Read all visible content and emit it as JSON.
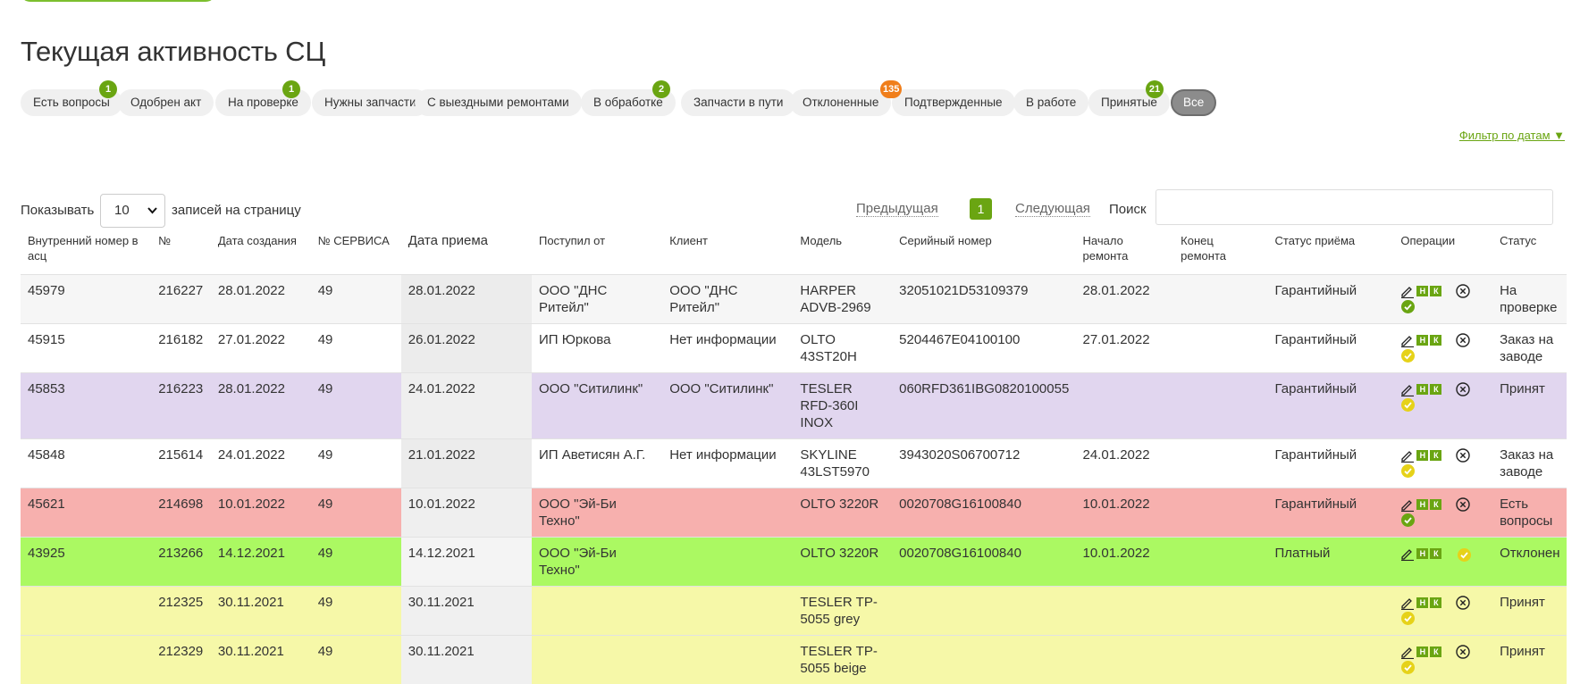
{
  "page": {
    "title": "Текущая активность СЦ",
    "date_filter": "Фильтр по датам ▼"
  },
  "filters": [
    {
      "label": "Есть вопросы",
      "badge": "1",
      "badge_color": "green"
    },
    {
      "label": "Одобрен акт",
      "badge": null
    },
    {
      "label": "На проверке",
      "badge": "1",
      "badge_color": "green"
    },
    {
      "label": "Нужны запчасти",
      "badge": null
    },
    {
      "label": "С выездными ремонтами",
      "badge": null
    },
    {
      "label": "В обработке",
      "badge": "2",
      "badge_color": "green"
    },
    {
      "label": "Запчасти в пути",
      "badge": null
    },
    {
      "label": "Отклоненные",
      "badge": null
    },
    {
      "label": "Подтвержденные",
      "badge": "135",
      "badge_color": "orange"
    },
    {
      "label": "В работе",
      "badge": null
    },
    {
      "label": "Принятые",
      "badge": "21",
      "badge_color": "green"
    },
    {
      "label": "Все",
      "badge": null,
      "active": true
    }
  ],
  "controls": {
    "show_label": "Показывать",
    "page_size": "10",
    "per_page_label": "записей на страницу",
    "prev": "Предыдущая",
    "page": "1",
    "next": "Следующая",
    "search_label": "Поиск",
    "search_value": ""
  },
  "table": {
    "headers": [
      "Внутренний номер в асц",
      "№",
      "Дата создания",
      "№ СЕРВИСА",
      "Дата приема",
      "Поступил от",
      "Клиент",
      "Модель",
      "Серийный номер",
      "Начало ремонта",
      "Конец ремонта",
      "Статус приёма",
      "Операции",
      "Статус"
    ],
    "ops_labels": {
      "h": "Н",
      "k": "К"
    },
    "rows": [
      {
        "style": "gray",
        "internal": "45979",
        "num": "216227",
        "created": "28.01.2022",
        "service": "49",
        "received": "28.01.2022",
        "from": "ООО \"ДНС Ритейл\"",
        "client": "ООО \"ДНС Ритейл\"",
        "model": "HARPER ADVB-2969",
        "serial": "32051021D53109379",
        "start": "28.01.2022",
        "end": "",
        "intake_status": "Гарантийный",
        "check_color": "#6aa512",
        "inline_check": false,
        "status": "На проверке"
      },
      {
        "style": "white",
        "internal": "45915",
        "num": "216182",
        "created": "27.01.2022",
        "service": "49",
        "received": "26.01.2022",
        "from": "ИП Юркова",
        "client": "Нет информации",
        "model": "OLTO 43ST20H",
        "serial": "5204467E04100100",
        "start": "27.01.2022",
        "end": "",
        "intake_status": "Гарантийный",
        "check_color": "#e6d219",
        "inline_check": false,
        "status": "Заказ на заводе"
      },
      {
        "style": "purple",
        "internal": "45853",
        "num": "216223",
        "created": "28.01.2022",
        "service": "49",
        "received": "24.01.2022",
        "from": "ООО \"Ситилинк\"",
        "client": "ООО \"Ситилинк\"",
        "model": "TESLER RFD-360I INOX",
        "serial": "060RFD361IBG0820100055",
        "start": "",
        "end": "",
        "intake_status": "Гарантийный",
        "check_color": "#e6d219",
        "inline_check": false,
        "status": "Принят"
      },
      {
        "style": "white",
        "internal": "45848",
        "num": "215614",
        "created": "24.01.2022",
        "service": "49",
        "received": "21.01.2022",
        "from": "ИП Аветисян А.Г.",
        "client": "Нет информации",
        "model": "SKYLINE 43LST5970",
        "serial": "3943020S06700712",
        "start": "24.01.2022",
        "end": "",
        "intake_status": "Гарантийный",
        "check_color": "#e6d219",
        "inline_check": false,
        "status": "Заказ на заводе"
      },
      {
        "style": "red",
        "internal": "45621",
        "num": "214698",
        "created": "10.01.2022",
        "service": "49",
        "received": "10.01.2022",
        "from": "ООО \"Эй-Би Техно\"",
        "client": "",
        "model": "OLTO 3220R",
        "serial": "0020708G16100840",
        "start": "10.01.2022",
        "end": "",
        "intake_status": "Гарантийный",
        "check_color": "#6aa512",
        "inline_check": false,
        "status": "Есть вопросы"
      },
      {
        "style": "lime",
        "internal": "43925",
        "num": "213266",
        "created": "14.12.2021",
        "service": "49",
        "received": "14.12.2021",
        "from": "ООО \"Эй-Би Техно\"",
        "client": "",
        "model": "OLTO 3220R",
        "serial": "0020708G16100840",
        "start": "10.01.2022",
        "end": "",
        "intake_status": "Платный",
        "check_color": "#e6d219",
        "inline_check": true,
        "status": "Отклонен"
      },
      {
        "style": "yellow",
        "internal": "",
        "num": "212325",
        "created": "30.11.2021",
        "service": "49",
        "received": "30.11.2021",
        "from": "",
        "client": "",
        "model": "TESLER TP-5055 grey",
        "serial": "",
        "start": "",
        "end": "",
        "intake_status": "",
        "check_color": "#e6d219",
        "inline_check": false,
        "status": "Принят"
      },
      {
        "style": "yellow",
        "internal": "",
        "num": "212329",
        "created": "30.11.2021",
        "service": "49",
        "received": "30.11.2021",
        "from": "",
        "client": "",
        "model": "TESLER TP-5055 beige",
        "serial": "",
        "start": "",
        "end": "",
        "intake_status": "",
        "check_color": "#e6d219",
        "inline_check": false,
        "status": "Принят"
      }
    ]
  }
}
